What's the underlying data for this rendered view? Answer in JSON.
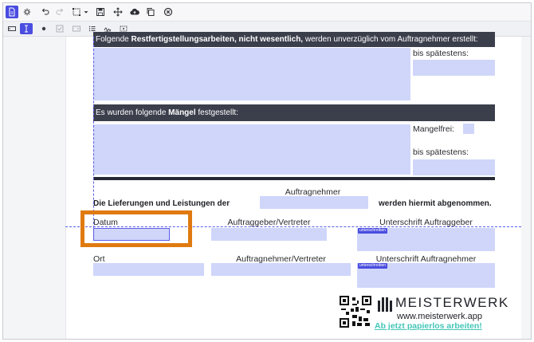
{
  "toolbar": {
    "icons": [
      "document-icon",
      "gear-edit-icon",
      "undo-icon",
      "redo-icon",
      "select-area-icon",
      "dropdown-caret-icon",
      "save-icon",
      "move-icon",
      "cloud-upload-icon",
      "copy-icon",
      "close-circle-icon"
    ]
  },
  "subbar": {
    "icons": [
      "text-field-icon",
      "text-cursor-icon",
      "radio-icon",
      "checkbox-icon",
      "dropdown-field-icon",
      "list-icon",
      "signature-icon",
      "image-icon"
    ]
  },
  "form": {
    "section1_prefix": "Folgende ",
    "section1_bold": "Restfertigstellungsarbeiten, nicht wesentlich,",
    "section1_suffix": " werden unverzüglich vom Auftragnehmer erstellt:",
    "deadline1_label": "bis spätestens:",
    "section2_prefix": "Es wurden folgende ",
    "section2_bold": "Mängel",
    "section2_suffix": " festgestellt:",
    "defect_free_label": "Mangelfrei:",
    "deadline2_label": "bis spätestens:",
    "acceptance_prefix": "Die Lieferungen und Leistungen der",
    "contractor_label": "Auftragnehmer",
    "acceptance_suffix": "werden hiermit abgenommen.",
    "date_label": "Datum",
    "client_rep_label": "Auftraggeber/Vertreter",
    "client_signature_label": "Unterschrift Auftraggeber",
    "sign_badge_1": "unterschreiben",
    "place_label": "Ort",
    "contractor_rep_label": "Auftragnehmer/Vertreter",
    "contractor_signature_label": "Unterschrift Auftragnehmer",
    "sign_badge_2": "unterschreiben"
  },
  "branding": {
    "name": "MEISTERWERK",
    "website": "www.meisterwerk.app",
    "slogan": "Ab jetzt papierlos arbeiten!"
  },
  "colors": {
    "accent": "#4a4de0",
    "field": "#cfd6fa",
    "highlight": "#e07a10",
    "header_bar": "#3b3f4c",
    "slogan": "#44c6b8"
  }
}
